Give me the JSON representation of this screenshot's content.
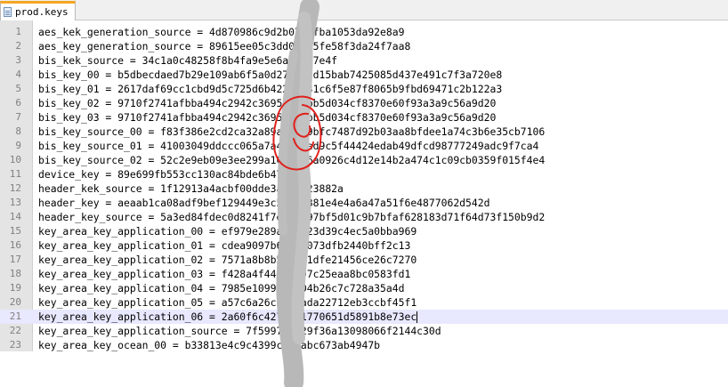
{
  "tab": {
    "title": "prod.keys"
  },
  "editor": {
    "current_line": 21,
    "lines": [
      {
        "num": "1",
        "text": "aes_kek_generation_source = 4d870986c9d2b0722fba1053da92e8a9"
      },
      {
        "num": "2",
        "text": "aes_key_generation_source = 89615ee05c3dd06805fe58f3da24f7aa8"
      },
      {
        "num": "3",
        "text": "bis_kek_source = 34c1a0c48258f8b4fa9e5e6adafc7e4f"
      },
      {
        "num": "4",
        "text": "bis_key_00 = b5dbecdaed7b29e109ab6f5a0d276c89d15bab7425085d437e491c7f3a720e8"
      },
      {
        "num": "5",
        "text": "bis_key_01 = 2617daf69cc1cbd9d5c725d6b422cb831c6f5e87f8065b9fbd69471c2b122a3"
      },
      {
        "num": "6",
        "text": "bis_key_02 = 9710f2741afbba494c2942c3695deafbb5d034cf8370e60f93a3a9c56a9d20"
      },
      {
        "num": "7",
        "text": "bis_key_03 = 9710f2741afbba494c2942c3695deafbb5d034cf8370e60f93a3a9c56a9d20"
      },
      {
        "num": "8",
        "text": "bis_key_source_00 = f83f386e2cd2ca32a89abea29bfc7487d92b03aa8bfdee1a74c3b6e35cb7106"
      },
      {
        "num": "9",
        "text": "bis_key_source_01 = 41003049ddccc065a7a4b41eed9c5f44424edab49dfcd98777249adc9f7ca4"
      },
      {
        "num": "10",
        "text": "bis_key_source_02 = 52c2e9eb09e3ee299a10c1fb6a0926c4d12e14b2a474c1c09cb0359f015f4e4"
      },
      {
        "num": "11",
        "text": "device_key = 89e699fb553cc130ac84bde6b47bff6"
      },
      {
        "num": "12",
        "text": "header_kek_source = 1f12913a4acbf00dde3af6d523882a"
      },
      {
        "num": "13",
        "text": "header_key = aeaab1ca08adf9bef129449e3c567d6881e4e4a6a47a51f6e4877062d542d"
      },
      {
        "num": "14",
        "text": "header_key_source = 5a3ed84fdec0d8241f7e25d197bf5d01c9b7bfaf628183d71f64d73f150b9d2"
      },
      {
        "num": "15",
        "text": "key_area_key_application_00 = ef979e289a132c23d39c4ec5a0bba969"
      },
      {
        "num": "16",
        "text": "key_area_key_application_01 = cdea9097b69729073dfb2440bff2c13"
      },
      {
        "num": "17",
        "text": "key_area_key_application_02 = 7571a8b8b524a01dfe21456ce26c7270"
      },
      {
        "num": "18",
        "text": "key_area_key_application_03 = f428a4f44cf5707c25eaa8bc0583fd1"
      },
      {
        "num": "19",
        "text": "key_area_key_application_04 = 7985e1099eb6a04b26c7c728a35a4d"
      },
      {
        "num": "20",
        "text": "key_area_key_application_05 = a57c6a26c5410ada22712eb3ccbf45f1"
      },
      {
        "num": "21",
        "text": "key_area_key_application_06 = 2a60f6c4275df1770651d5891b8e73ec"
      },
      {
        "num": "22",
        "text": "key_area_key_application_source = 7f59971e629f36a13098066f2144c30d"
      },
      {
        "num": "23",
        "text": "key_area_key_ocean_00 = b33813e4c9c4399c75fabc673ab4947b"
      }
    ]
  },
  "colors": {
    "tab_accent": "#f5a623",
    "current_line_bg": "#e8e8ff",
    "gutter_bg": "#e4e4e4",
    "redaction_gray": "#b8b8b8",
    "annotation_red": "#e0201c"
  }
}
